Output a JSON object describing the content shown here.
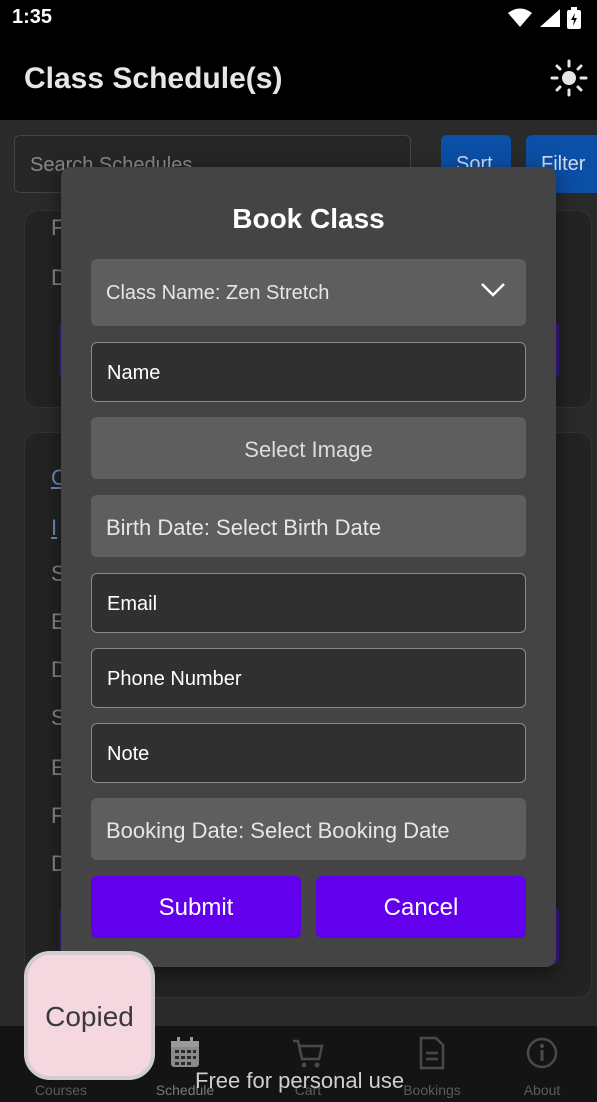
{
  "status_bar": {
    "time": "1:35",
    "icons": [
      "wifi-icon",
      "signal-icon",
      "battery-icon"
    ]
  },
  "app_bar": {
    "title": "Class Schedule(s)",
    "action_icon": "brightness-icon"
  },
  "background": {
    "search_placeholder": "Search Schedules",
    "sort_label": "Sort",
    "filter_label": "Filter",
    "card1_letters": [
      "F",
      "D"
    ],
    "card2_letters": [
      "C",
      "I",
      "S",
      "E",
      "D",
      "S",
      "E",
      "F",
      "D"
    ]
  },
  "dialog": {
    "title": "Book Class",
    "class_name": "Class Name: Zen Stretch",
    "name_label": "Name",
    "select_image_label": "Select Image",
    "birth_date_label": "Birth Date: Select Birth Date",
    "email_label": "Email",
    "phone_label": "Phone Number",
    "note_label": "Note",
    "booking_date_label": "Booking Date: Select Booking Date",
    "submit_label": "Submit",
    "cancel_label": "Cancel"
  },
  "toast": {
    "text": "Copied"
  },
  "bottom_nav": {
    "items": [
      {
        "label": "Courses",
        "icon": "home-icon"
      },
      {
        "label": "Schedule",
        "icon": "calendar-icon"
      },
      {
        "label": "Cart",
        "icon": "cart-icon"
      },
      {
        "label": "Bookings",
        "icon": "document-icon"
      },
      {
        "label": "About",
        "icon": "info-icon"
      }
    ],
    "active_index": 1
  },
  "watermark": "Free for personal use",
  "colors": {
    "primary": "#6200ee",
    "dialog_bg": "#444444",
    "toast_bg": "#f5d7e0",
    "secondary_button": "#0b4fa6"
  }
}
